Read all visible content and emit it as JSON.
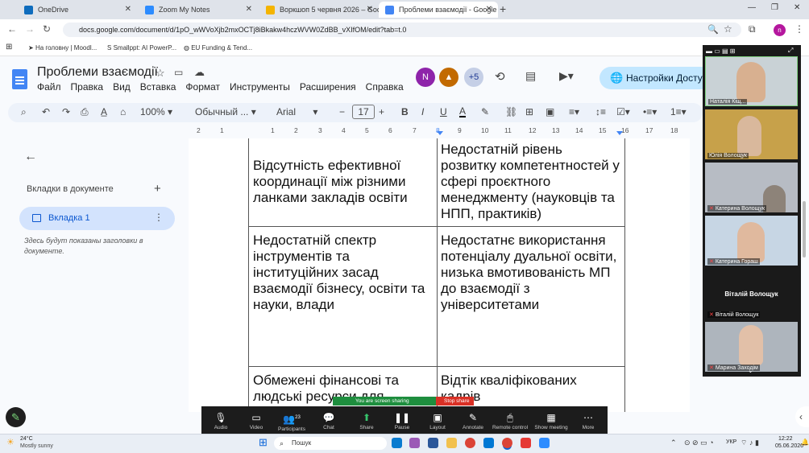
{
  "browser": {
    "tabs": [
      {
        "title": "OneDrive",
        "color": "#0f6cbd"
      },
      {
        "title": "Zoom My Notes",
        "color": "#2d8cff"
      },
      {
        "title": "Воркшоп 5 червня 2026 – Goo",
        "color": "#f4b400"
      },
      {
        "title": "Проблеми взаємодії - Google",
        "color": "#4285f4"
      }
    ],
    "url": "docs.google.com/document/d/1pO_wWVoXjb2mxOCTj8iBkakw4hczWVW0ZdBB_vXIfOM/edit?tab=t.0",
    "bookmarks": [
      "На головну | Moodl...",
      "Smallppt: AI PowerP...",
      "EU Funding & Tend..."
    ],
    "profile_initial": "n"
  },
  "docs": {
    "title": "Проблеми взаємодії",
    "menus": [
      "Файл",
      "Правка",
      "Вид",
      "Вставка",
      "Формат",
      "Инструменты",
      "Расширения",
      "Справка"
    ],
    "collab_initial": "N",
    "collab_more": "+5",
    "share_label": "Настройки Досту",
    "toolbar": {
      "zoom": "100%",
      "style": "Обычный ...",
      "font": "Arial",
      "size": "17"
    },
    "ruler": [
      "2",
      "1",
      "1",
      "2",
      "3",
      "4",
      "5",
      "6",
      "7",
      "8",
      "9",
      "10",
      "11",
      "12",
      "13",
      "14",
      "15",
      "16",
      "17",
      "18"
    ],
    "sidebar": {
      "heading": "Вкладки в документе",
      "tab_label": "Вкладка 1",
      "hint": "Здесь будут показаны заголовки в документе."
    },
    "table": [
      [
        "Відсутність ефективної координації між різними ланками закладів освіти",
        "Недостатній рівень розвитку компетентностей у сфері проєктного менеджменту (науковців та НПП, практиків)"
      ],
      [
        "Недостатній спектр інструментів та інституційних засад взаємодії бізнесу, освіти та науки, влади",
        "Недостатнє використання потенціалу дуальної освіти, низька вмотивованість МП до взаємодії з університетами"
      ],
      [
        "Обмежені фінансові та людські ресурси для",
        "Відтік кваліфікованих кадрів"
      ]
    ]
  },
  "zoom": {
    "participants": [
      {
        "name": "Наталія Кіщ...",
        "bg": "#c9d2d6"
      },
      {
        "name": "Юлія Волощук",
        "bg": "#c7a14a"
      },
      {
        "name": "Катерина Волощук",
        "bg": "#b7bcc4"
      },
      {
        "name": "Катерина Гораш",
        "bg": "#c7d6e4"
      },
      {
        "name": "Віталій Волощук",
        "bg": "#1a1a1a",
        "title": "Віталій Волощук"
      },
      {
        "name": "Марина Заходім",
        "bg": "#aeb5bd"
      }
    ],
    "controls": [
      "Audio",
      "Video",
      "Participants",
      "Chat",
      "Share",
      "Pause",
      "Layout",
      "Annotate",
      "Remote control",
      "Show meeting",
      "More"
    ],
    "participants_count": "23",
    "sharing_text": "You are screen sharing",
    "stop_text": "Stop share"
  },
  "taskbar": {
    "weather_temp": "24°C",
    "weather_desc": "Mostly sunny",
    "search": "Пошук",
    "lang": "УКР",
    "time": "12:22",
    "date": "05.06.2026"
  }
}
